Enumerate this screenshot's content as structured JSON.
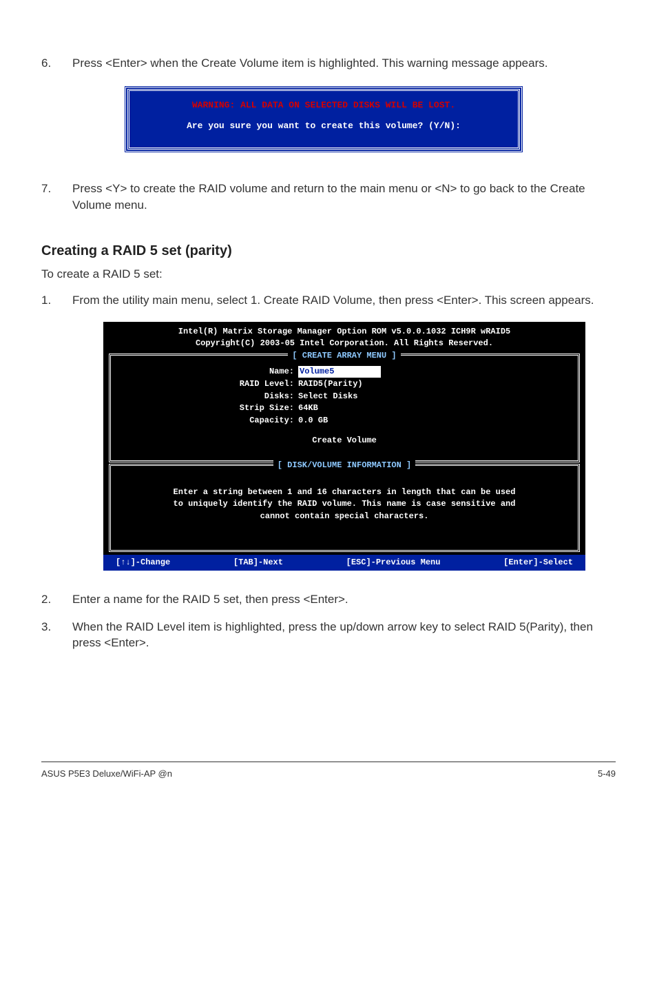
{
  "step6": {
    "num": "6.",
    "text": "Press <Enter> when the Create Volume item is highlighted. This warning message appears."
  },
  "warning": {
    "line1": "WARNING: ALL DATA ON SELECTED DISKS WILL BE LOST.",
    "line2": "Are you sure you want to create this volume? (Y/N):"
  },
  "step7": {
    "num": "7.",
    "text": "Press <Y> to create the RAID volume and return to the main menu or <N> to go back to the Create Volume menu."
  },
  "sectionHead": "Creating a RAID 5 set (parity)",
  "sectionIntro": "To create a RAID 5 set:",
  "step1": {
    "num": "1.",
    "text": "From the utility main menu, select 1. Create RAID Volume, then press <Enter>. This screen appears."
  },
  "bios": {
    "header1": "Intel(R) Matrix Storage Manager Option ROM v5.0.0.1032 ICH9R wRAID5",
    "header2": "Copyright(C) 2003-05 Intel Corporation. All Rights Reserved.",
    "boxTitle": "[ CREATE ARRAY MENU ]",
    "fields": {
      "nameLabel": "Name:",
      "nameValue": "Volume5",
      "raidLabel": "RAID Level:",
      "raidValue": "RAID5(Parity)",
      "disksLabel": "Disks:",
      "disksValue": "Select Disks",
      "stripLabel": "Strip Size:",
      "stripValue": "64KB",
      "capLabel": "Capacity:",
      "capValue": "0.0  GB"
    },
    "create": "Create Volume",
    "helpTitle": "[ DISK/VOLUME INFORMATION ]",
    "helpLine1": "Enter a string between 1 and 16 characters in length that can be used",
    "helpLine2": "to uniquely identify the RAID volume. This name is case sensitive and",
    "helpLine3": "cannot contain special characters.",
    "footer": {
      "change": "[↑↓]-Change",
      "next": "[TAB]-Next",
      "prev": "[ESC]-Previous Menu",
      "select": "[Enter]-Select"
    }
  },
  "step2": {
    "num": "2.",
    "text": "Enter a name for the RAID 5 set, then press <Enter>."
  },
  "step3": {
    "num": "3.",
    "text": "When the RAID Level item is highlighted, press the up/down arrow key to select RAID 5(Parity), then press <Enter>."
  },
  "footer": {
    "left": "ASUS P5E3 Deluxe/WiFi-AP @n",
    "right": "5-49"
  }
}
